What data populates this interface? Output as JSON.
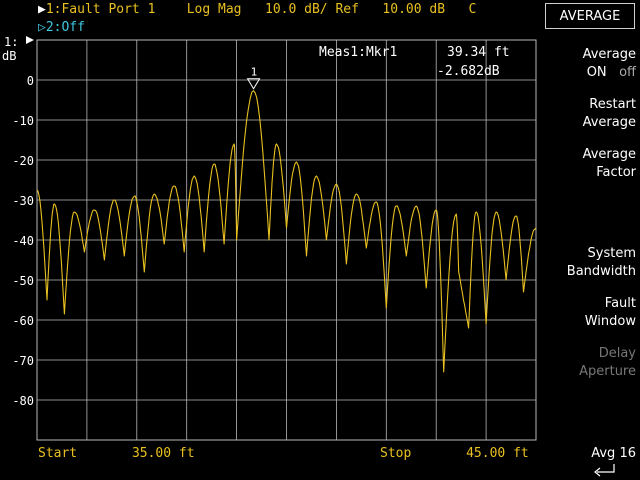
{
  "header": {
    "trace1": {
      "marker": "▶",
      "label": "1:Fault Port 1",
      "format": "Log Mag",
      "scale": "10.0 dB/",
      "ref_label": "Ref",
      "ref_value": "10.00 dB",
      "flag": "C"
    },
    "trace2": {
      "label": "▷2:Off"
    },
    "axis_unit": "dB",
    "trace_tag": "1:"
  },
  "measurement": {
    "label": "Meas1:Mkr1",
    "distance": "39.34 ft",
    "value": "-2.682dB",
    "marker_number": "1"
  },
  "softkeys": {
    "title": "AVERAGE",
    "items": [
      {
        "line1": "Average",
        "line2": "ON",
        "line2_off": "off",
        "disabled": false
      },
      {
        "line1": "Restart",
        "line2": "Average",
        "disabled": false
      },
      {
        "line1": "Average",
        "line2": "Factor",
        "disabled": false
      },
      {
        "line1": "System",
        "line2": "Bandwidth",
        "disabled": false
      },
      {
        "line1": "Fault",
        "line2": "Window",
        "disabled": false
      },
      {
        "line1": "Delay",
        "line2": "Aperture",
        "disabled": true
      }
    ],
    "status": "Avg 16",
    "enter_icon": "enter-return-icon"
  },
  "footer": {
    "start_label": "Start",
    "start_value": "35.00 ft",
    "stop_label": "Stop",
    "stop_value": "45.00 ft"
  },
  "colors": {
    "trace": "#e8c020",
    "grid": "#b8b8b8",
    "trace2": "#3fc8e0",
    "text": "#ffffff"
  },
  "chart_data": {
    "type": "line",
    "x_range": [
      35.0,
      45.0
    ],
    "x_unit": "ft",
    "ylim": [
      -90,
      10
    ],
    "y_ticks": [
      0,
      -10,
      -20,
      -30,
      -40,
      -50,
      -60,
      -70,
      -80
    ],
    "grid": true,
    "marker": {
      "x": 39.34,
      "y": -2.682,
      "label": "1"
    },
    "series": [
      {
        "peaks": [
          {
            "x": 35.0,
            "y": -27.5
          },
          {
            "x": 35.35,
            "y": -31
          },
          {
            "x": 35.75,
            "y": -33
          },
          {
            "x": 36.15,
            "y": -32.5
          },
          {
            "x": 36.55,
            "y": -30
          },
          {
            "x": 36.95,
            "y": -29
          },
          {
            "x": 37.35,
            "y": -28.5
          },
          {
            "x": 37.75,
            "y": -26.5
          },
          {
            "x": 38.15,
            "y": -24
          },
          {
            "x": 38.55,
            "y": -21
          },
          {
            "x": 38.95,
            "y": -16
          },
          {
            "x": 39.34,
            "y": -2.682
          },
          {
            "x": 39.8,
            "y": -16
          },
          {
            "x": 40.2,
            "y": -20.5
          },
          {
            "x": 40.6,
            "y": -24
          },
          {
            "x": 41.0,
            "y": -26
          },
          {
            "x": 41.4,
            "y": -28.5
          },
          {
            "x": 41.8,
            "y": -30.5
          },
          {
            "x": 42.2,
            "y": -31.5
          },
          {
            "x": 42.6,
            "y": -31.5
          },
          {
            "x": 43.0,
            "y": -32.5
          },
          {
            "x": 43.4,
            "y": -33.5
          },
          {
            "x": 43.8,
            "y": -33
          },
          {
            "x": 44.2,
            "y": -33
          },
          {
            "x": 44.6,
            "y": -34
          },
          {
            "x": 45.0,
            "y": -37
          }
        ],
        "nulls": [
          {
            "x": 35.2,
            "y": -55
          },
          {
            "x": 35.55,
            "y": -58.5
          },
          {
            "x": 35.95,
            "y": -43
          },
          {
            "x": 36.35,
            "y": -45
          },
          {
            "x": 36.75,
            "y": -44
          },
          {
            "x": 37.15,
            "y": -48
          },
          {
            "x": 37.55,
            "y": -41
          },
          {
            "x": 37.95,
            "y": -43
          },
          {
            "x": 38.35,
            "y": -43
          },
          {
            "x": 38.75,
            "y": -41
          },
          {
            "x": 39.0,
            "y": -40
          },
          {
            "x": 39.65,
            "y": -40
          },
          {
            "x": 40.0,
            "y": -37
          },
          {
            "x": 40.4,
            "y": -44
          },
          {
            "x": 40.8,
            "y": -40
          },
          {
            "x": 41.2,
            "y": -46
          },
          {
            "x": 41.6,
            "y": -42
          },
          {
            "x": 42.0,
            "y": -57
          },
          {
            "x": 42.4,
            "y": -44
          },
          {
            "x": 42.8,
            "y": -52
          },
          {
            "x": 43.15,
            "y": -73
          },
          {
            "x": 43.45,
            "y": -48
          },
          {
            "x": 43.65,
            "y": -62
          },
          {
            "x": 44.0,
            "y": -61
          },
          {
            "x": 44.4,
            "y": -50
          },
          {
            "x": 44.75,
            "y": -53
          }
        ]
      }
    ]
  }
}
